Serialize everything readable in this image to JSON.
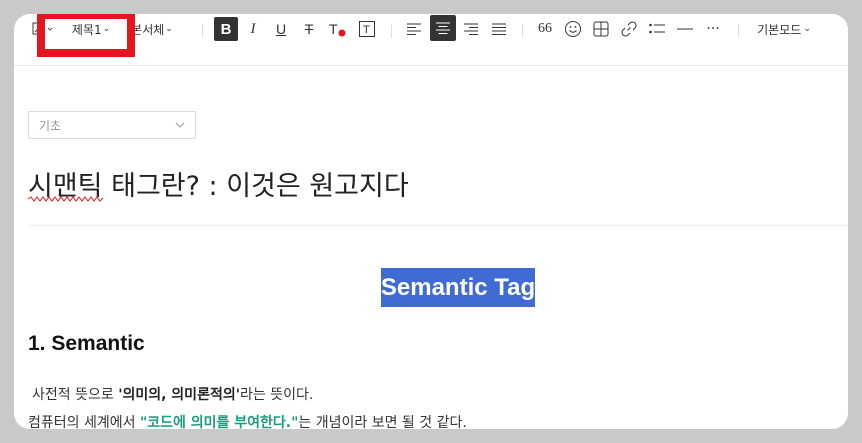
{
  "toolbar": {
    "style_dropdown": "제목1",
    "font_dropdown": "본서체",
    "mode_dropdown": "기본모드",
    "quote_glyph": "66",
    "more_glyph": "···"
  },
  "editor": {
    "category_select": "기초",
    "post_title": "시맨틱 태그란? : 이것은 원고지다",
    "highlighted_heading": "Semantic Tag",
    "section_heading": "1. Semantic",
    "para1_before": "사전적 뜻으로 ",
    "para1_bold": "'의미의, 의미론적의'",
    "para1_after": "라는 뜻이다.",
    "para2_before": "컴퓨터의 세계에서 ",
    "para2_green": "\"코드에 의미를 부여한다.\"",
    "para2_after": "는 개념이라 보면 될 것 같다."
  },
  "colors": {
    "highlight_bg": "#3f6bd2",
    "annotation_red": "#e4161f",
    "accent_green": "#1a9c7d"
  }
}
